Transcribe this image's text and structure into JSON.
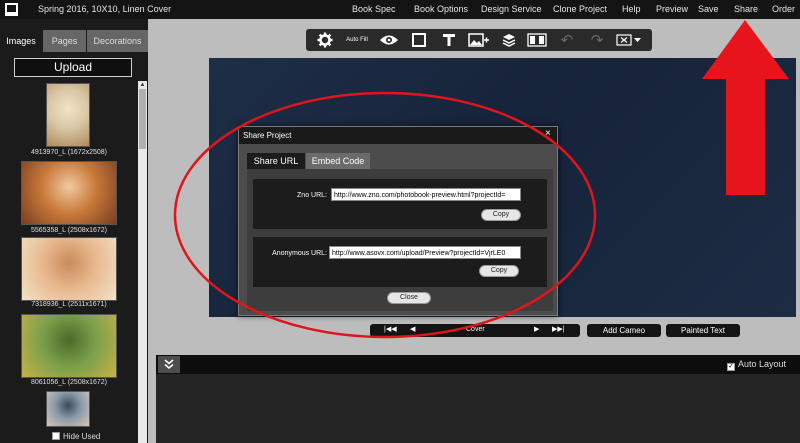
{
  "app": {
    "doc_title": "Spring 2016, 10X10, Linen Cover"
  },
  "menu": [
    {
      "id": "book-spec",
      "label": "Book Spec"
    },
    {
      "id": "book-options",
      "label": "Book Options"
    },
    {
      "id": "design-service",
      "label": "Design Service"
    },
    {
      "id": "clone-project",
      "label": "Clone Project"
    },
    {
      "id": "help",
      "label": "Help"
    },
    {
      "id": "preview",
      "label": "Preview"
    },
    {
      "id": "save",
      "label": "Save"
    },
    {
      "id": "share",
      "label": "Share"
    },
    {
      "id": "order",
      "label": "Order"
    }
  ],
  "left_panel": {
    "tabs": [
      "Images",
      "Pages",
      "Decorations"
    ],
    "active_tab": "Images",
    "upload_label": "Upload",
    "images": [
      {
        "caption": "4913970_L (1672x2508)",
        "palette": [
          "#d9c7a6",
          "#b08a5c",
          "#f3e4c8"
        ]
      },
      {
        "caption": "5565358_L (2508x1672)",
        "palette": [
          "#c97a3a",
          "#7a3d1e",
          "#f0c9a0"
        ]
      },
      {
        "caption": "7318936_L (2511x1671)",
        "palette": [
          "#e8b98f",
          "#f4e2c8",
          "#c98a5a"
        ]
      },
      {
        "caption": "8061056_L (2508x1672)",
        "palette": [
          "#7aa04a",
          "#c8b04a",
          "#4a6a2a"
        ]
      },
      {
        "caption": "",
        "palette": [
          "#8a9aa8",
          "#d8c8b8",
          "#3a4a5a"
        ]
      }
    ],
    "hide_used_label": "Hide Used"
  },
  "toolbar": {
    "auto_fill_label": "Auto Fill",
    "tools": [
      "gear-icon",
      "auto-fill",
      "eye-icon",
      "square-icon",
      "text-icon",
      "add-image-icon",
      "layers-icon",
      "grid-icon",
      "undo-icon",
      "redo-icon",
      "delete-dropdown-icon"
    ]
  },
  "page_nav": {
    "current_page": "Cover",
    "add_cameo_label": "Add Cameo",
    "painted_text_label": "Painted Text"
  },
  "tray": {
    "auto_layout_label": "Auto Layout",
    "auto_layout_checked": true
  },
  "dialog": {
    "title": "Share Project",
    "close_glyph": "×",
    "tabs": [
      "Share URL",
      "Embed Code"
    ],
    "active_tab": "Share URL",
    "zno_url_label": "Zno URL:",
    "zno_url_value": "http://www.zno.com/photobook-preview.html?projectId=",
    "anon_url_label": "Anonymous URL:",
    "anon_url_value": "http://www.asovx.com/upload/Preview?projectId=VjrLE0",
    "copy_label": "Copy",
    "close_label": "Close"
  },
  "annotation": {
    "ellipse_color": "#e0141b",
    "arrow_color": "#e8141c"
  }
}
